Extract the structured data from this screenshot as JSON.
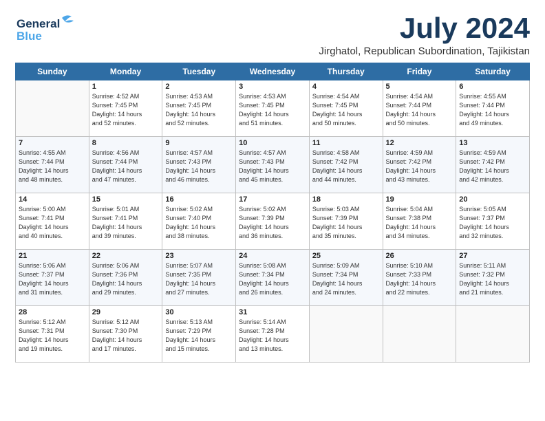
{
  "logo": {
    "line1": "General",
    "line2": "Blue"
  },
  "title": "July 2024",
  "subtitle": "Jirghatol, Republican Subordination, Tajikistan",
  "columns": [
    "Sunday",
    "Monday",
    "Tuesday",
    "Wednesday",
    "Thursday",
    "Friday",
    "Saturday"
  ],
  "weeks": [
    [
      {
        "day": "",
        "detail": ""
      },
      {
        "day": "1",
        "detail": "Sunrise: 4:52 AM\nSunset: 7:45 PM\nDaylight: 14 hours\nand 52 minutes."
      },
      {
        "day": "2",
        "detail": "Sunrise: 4:53 AM\nSunset: 7:45 PM\nDaylight: 14 hours\nand 52 minutes."
      },
      {
        "day": "3",
        "detail": "Sunrise: 4:53 AM\nSunset: 7:45 PM\nDaylight: 14 hours\nand 51 minutes."
      },
      {
        "day": "4",
        "detail": "Sunrise: 4:54 AM\nSunset: 7:45 PM\nDaylight: 14 hours\nand 50 minutes."
      },
      {
        "day": "5",
        "detail": "Sunrise: 4:54 AM\nSunset: 7:44 PM\nDaylight: 14 hours\nand 50 minutes."
      },
      {
        "day": "6",
        "detail": "Sunrise: 4:55 AM\nSunset: 7:44 PM\nDaylight: 14 hours\nand 49 minutes."
      }
    ],
    [
      {
        "day": "7",
        "detail": "Sunrise: 4:55 AM\nSunset: 7:44 PM\nDaylight: 14 hours\nand 48 minutes."
      },
      {
        "day": "8",
        "detail": "Sunrise: 4:56 AM\nSunset: 7:44 PM\nDaylight: 14 hours\nand 47 minutes."
      },
      {
        "day": "9",
        "detail": "Sunrise: 4:57 AM\nSunset: 7:43 PM\nDaylight: 14 hours\nand 46 minutes."
      },
      {
        "day": "10",
        "detail": "Sunrise: 4:57 AM\nSunset: 7:43 PM\nDaylight: 14 hours\nand 45 minutes."
      },
      {
        "day": "11",
        "detail": "Sunrise: 4:58 AM\nSunset: 7:42 PM\nDaylight: 14 hours\nand 44 minutes."
      },
      {
        "day": "12",
        "detail": "Sunrise: 4:59 AM\nSunset: 7:42 PM\nDaylight: 14 hours\nand 43 minutes."
      },
      {
        "day": "13",
        "detail": "Sunrise: 4:59 AM\nSunset: 7:42 PM\nDaylight: 14 hours\nand 42 minutes."
      }
    ],
    [
      {
        "day": "14",
        "detail": "Sunrise: 5:00 AM\nSunset: 7:41 PM\nDaylight: 14 hours\nand 40 minutes."
      },
      {
        "day": "15",
        "detail": "Sunrise: 5:01 AM\nSunset: 7:41 PM\nDaylight: 14 hours\nand 39 minutes."
      },
      {
        "day": "16",
        "detail": "Sunrise: 5:02 AM\nSunset: 7:40 PM\nDaylight: 14 hours\nand 38 minutes."
      },
      {
        "day": "17",
        "detail": "Sunrise: 5:02 AM\nSunset: 7:39 PM\nDaylight: 14 hours\nand 36 minutes."
      },
      {
        "day": "18",
        "detail": "Sunrise: 5:03 AM\nSunset: 7:39 PM\nDaylight: 14 hours\nand 35 minutes."
      },
      {
        "day": "19",
        "detail": "Sunrise: 5:04 AM\nSunset: 7:38 PM\nDaylight: 14 hours\nand 34 minutes."
      },
      {
        "day": "20",
        "detail": "Sunrise: 5:05 AM\nSunset: 7:37 PM\nDaylight: 14 hours\nand 32 minutes."
      }
    ],
    [
      {
        "day": "21",
        "detail": "Sunrise: 5:06 AM\nSunset: 7:37 PM\nDaylight: 14 hours\nand 31 minutes."
      },
      {
        "day": "22",
        "detail": "Sunrise: 5:06 AM\nSunset: 7:36 PM\nDaylight: 14 hours\nand 29 minutes."
      },
      {
        "day": "23",
        "detail": "Sunrise: 5:07 AM\nSunset: 7:35 PM\nDaylight: 14 hours\nand 27 minutes."
      },
      {
        "day": "24",
        "detail": "Sunrise: 5:08 AM\nSunset: 7:34 PM\nDaylight: 14 hours\nand 26 minutes."
      },
      {
        "day": "25",
        "detail": "Sunrise: 5:09 AM\nSunset: 7:34 PM\nDaylight: 14 hours\nand 24 minutes."
      },
      {
        "day": "26",
        "detail": "Sunrise: 5:10 AM\nSunset: 7:33 PM\nDaylight: 14 hours\nand 22 minutes."
      },
      {
        "day": "27",
        "detail": "Sunrise: 5:11 AM\nSunset: 7:32 PM\nDaylight: 14 hours\nand 21 minutes."
      }
    ],
    [
      {
        "day": "28",
        "detail": "Sunrise: 5:12 AM\nSunset: 7:31 PM\nDaylight: 14 hours\nand 19 minutes."
      },
      {
        "day": "29",
        "detail": "Sunrise: 5:12 AM\nSunset: 7:30 PM\nDaylight: 14 hours\nand 17 minutes."
      },
      {
        "day": "30",
        "detail": "Sunrise: 5:13 AM\nSunset: 7:29 PM\nDaylight: 14 hours\nand 15 minutes."
      },
      {
        "day": "31",
        "detail": "Sunrise: 5:14 AM\nSunset: 7:28 PM\nDaylight: 14 hours\nand 13 minutes."
      },
      {
        "day": "",
        "detail": ""
      },
      {
        "day": "",
        "detail": ""
      },
      {
        "day": "",
        "detail": ""
      }
    ]
  ]
}
